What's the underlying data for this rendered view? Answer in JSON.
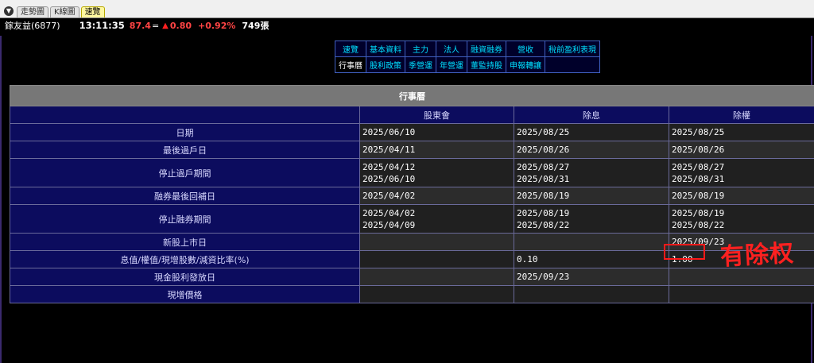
{
  "tabs": [
    {
      "label": "走勢圖"
    },
    {
      "label": "K線圖"
    },
    {
      "label": "速覽"
    }
  ],
  "quote": {
    "name": "鎵友益(6877)",
    "time": "13:11:35",
    "price": "87.4",
    "eq": "=",
    "arrow": "▲",
    "change": "0.80",
    "pct": "+0.92%",
    "volume": "749張"
  },
  "nav": {
    "row1": [
      "速覽",
      "基本資料",
      "主力",
      "法人",
      "融資融券",
      "營收",
      "稅前盈利表現"
    ],
    "row2": [
      "行事曆",
      "股利政策",
      "季營運",
      "年營運",
      "董監持股",
      "申報轉讓",
      ""
    ]
  },
  "table": {
    "title": "行事曆",
    "columns": [
      "股東會",
      "除息",
      "除權"
    ],
    "rows": [
      {
        "label": "日期",
        "values": [
          "2025/06/10",
          "2025/08/25",
          "2025/08/25"
        ]
      },
      {
        "label": "最後過戶日",
        "values": [
          "2025/04/11",
          "2025/08/26",
          "2025/08/26"
        ]
      },
      {
        "label": "停止過戶期間",
        "values": [
          "2025/04/12\n2025/06/10",
          "2025/08/27\n2025/08/31",
          "2025/08/27\n2025/08/31"
        ]
      },
      {
        "label": "融券最後回補日",
        "values": [
          "2025/04/02",
          "2025/08/19",
          "2025/08/19"
        ]
      },
      {
        "label": "停止融券期間",
        "values": [
          "2025/04/02\n2025/04/09",
          "2025/08/19\n2025/08/22",
          "2025/08/19\n2025/08/22"
        ]
      },
      {
        "label": "新股上市日",
        "values": [
          "",
          "",
          "2025/09/23"
        ]
      },
      {
        "label": "息值/權值/現增股數/減資比率(%)",
        "values": [
          "",
          "0.10",
          "1.00"
        ]
      },
      {
        "label": "現金股利發放日",
        "values": [
          "",
          "2025/09/23",
          ""
        ]
      },
      {
        "label": "現增價格",
        "values": [
          "",
          "",
          ""
        ]
      }
    ]
  },
  "annotation": {
    "text": "有除权",
    "color": "#ff2020"
  }
}
